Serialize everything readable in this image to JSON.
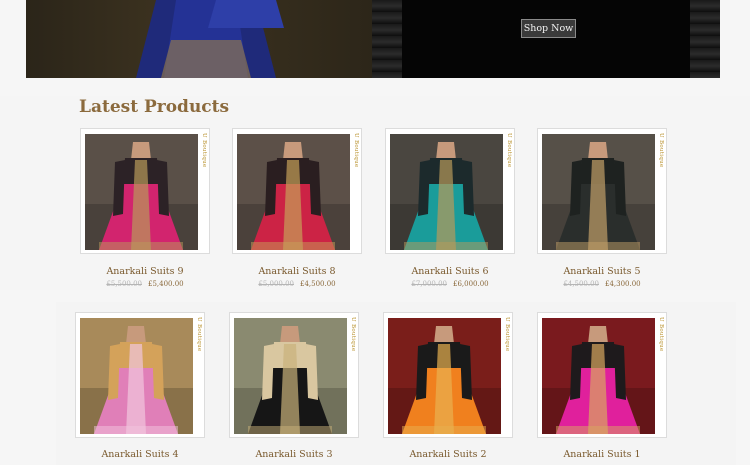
{
  "hero": {
    "shop_button": "Shop Now"
  },
  "section": {
    "title": "Latest Products"
  },
  "brand_tag": "U Boutique",
  "colors": {
    "brand_text": "#8b6a3d",
    "price_old": "#b5b5b5"
  },
  "products_row1": [
    {
      "name": "Anarkali Suits 9",
      "old_price": "£5,500.00",
      "new_price": "£5,400.00",
      "dress": "#d2246e",
      "top": "#2c2226",
      "embroid": "#b89a5a",
      "bg": "#5a5048"
    },
    {
      "name": "Anarkali Suits 8",
      "old_price": "£5,000.00",
      "new_price": "£4,500.00",
      "dress": "#cc2345",
      "top": "#2a1e20",
      "embroid": "#c6a058",
      "bg": "#5c5048"
    },
    {
      "name": "Anarkali Suits 6",
      "old_price": "£7,000.00",
      "new_price": "£6,000.00",
      "dress": "#1a9c9a",
      "top": "#1c2a2c",
      "embroid": "#b89a5a",
      "bg": "#4a4640"
    },
    {
      "name": "Anarkali Suits 5",
      "old_price": "£4,500.00",
      "new_price": "£4,300.00",
      "dress": "#2a2e2c",
      "top": "#1e2220",
      "embroid": "#c2a068",
      "bg": "#565048"
    }
  ],
  "products_row2": [
    {
      "name": "Anarkali Suits 4",
      "old_price": "",
      "new_price": "",
      "dress": "#e07fb8",
      "top": "#d4a25a",
      "embroid": "#f1c6dd",
      "bg": "#a88a5a"
    },
    {
      "name": "Anarkali Suits 3",
      "old_price": "",
      "new_price": "",
      "dress": "#161616",
      "top": "#d9c7a0",
      "embroid": "#c9b27a",
      "bg": "#8a8a70"
    },
    {
      "name": "Anarkali Suits 2",
      "old_price": "",
      "new_price": "",
      "dress": "#f0801e",
      "top": "#1a1a1a",
      "embroid": "#e8b050",
      "bg": "#7a1e1a"
    },
    {
      "name": "Anarkali Suits 1",
      "old_price": "",
      "new_price": "",
      "dress": "#e0209c",
      "top": "#1e1a1c",
      "embroid": "#d8a860",
      "bg": "#7a1a1e"
    }
  ]
}
